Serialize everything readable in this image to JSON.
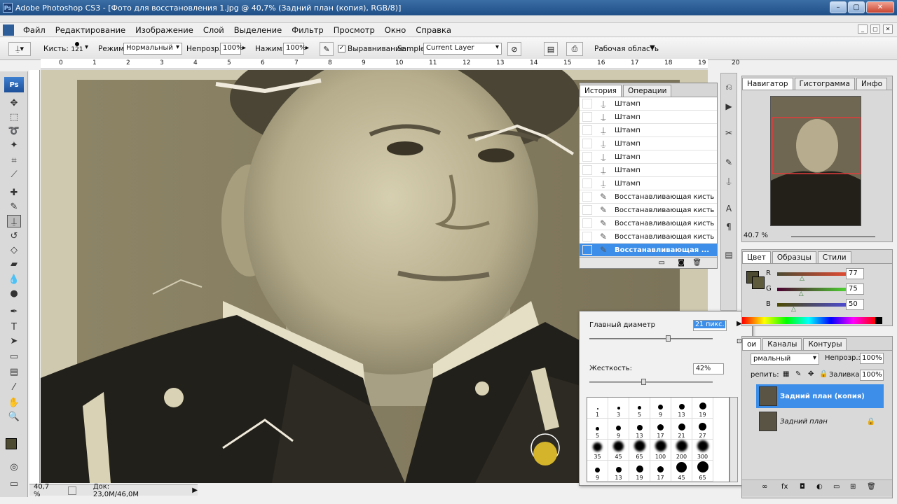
{
  "window": {
    "title": "Adobe Photoshop CS3 - [Фото для восстановления 1.jpg @ 40,7% (Задний план (копия), RGB/8)]",
    "app_badge": "Ps",
    "buttons": [
      "–",
      "▢",
      "✕"
    ]
  },
  "menu": {
    "items": [
      "Файл",
      "Редактирование",
      "Изображение",
      "Слой",
      "Выделение",
      "Фильтр",
      "Просмотр",
      "Окно",
      "Справка"
    ]
  },
  "options": {
    "brush_label": "Кисть:",
    "brush_size": "121",
    "mode_label": "Режим:",
    "mode_value": "Нормальный",
    "opacity_label": "Непрозр.:",
    "opacity_value": "100%",
    "flow_label": "Нажим:",
    "flow_value": "100%",
    "aligned_label": "Выравнивание",
    "sample_label": "Sample:",
    "sample_value": "Current Layer",
    "workspace_label": "Рабочая область"
  },
  "ruler": {
    "ticks": [
      "0",
      "1",
      "2",
      "3",
      "4",
      "5",
      "6",
      "7",
      "8",
      "9",
      "10",
      "11",
      "12",
      "13",
      "14",
      "15",
      "16",
      "17",
      "18",
      "19",
      "20"
    ]
  },
  "status": {
    "zoom": "40,7 %",
    "doc": "Док: 23,0M/46,0M"
  },
  "history": {
    "tabs": [
      "История",
      "Операции"
    ],
    "items": [
      {
        "label": "Штамп",
        "icon": "stamp-icon"
      },
      {
        "label": "Штамп",
        "icon": "stamp-icon"
      },
      {
        "label": "Штамп",
        "icon": "stamp-icon"
      },
      {
        "label": "Штамп",
        "icon": "stamp-icon"
      },
      {
        "label": "Штамп",
        "icon": "stamp-icon"
      },
      {
        "label": "Штамп",
        "icon": "stamp-icon"
      },
      {
        "label": "Штамп",
        "icon": "stamp-icon"
      },
      {
        "label": "Восстанавливающая кисть",
        "icon": "healing-brush-icon"
      },
      {
        "label": "Восстанавливающая кисть",
        "icon": "healing-brush-icon"
      },
      {
        "label": "Восстанавливающая кисть",
        "icon": "healing-brush-icon"
      },
      {
        "label": "Восстанавливающая кисть",
        "icon": "healing-brush-icon"
      },
      {
        "label": "Восстанавливающая ...",
        "icon": "healing-brush-icon"
      }
    ]
  },
  "brush_popup": {
    "diameter_label": "Главный диаметр",
    "diameter_value": "21 пикс.",
    "diameter_fraction": 0.62,
    "hardness_label": "Жесткость:",
    "hardness_value": "42%",
    "hardness_fraction": 0.42,
    "presets": [
      "1",
      "3",
      "5",
      "9",
      "13",
      "19",
      "5",
      "9",
      "13",
      "17",
      "21",
      "27",
      "35",
      "45",
      "65",
      "100",
      "200",
      "300",
      "9",
      "13",
      "19",
      "17",
      "45",
      "65"
    ]
  },
  "navigator": {
    "tabs": [
      "Навигатор",
      "Гистограмма",
      "Инфо"
    ],
    "zoom": "40.7 %"
  },
  "color_panel": {
    "tabs": [
      "Цвет",
      "Образцы",
      "Стили"
    ],
    "channels": [
      {
        "label": "R",
        "value": "77",
        "fraction": 0.3
      },
      {
        "label": "G",
        "value": "75",
        "fraction": 0.29
      },
      {
        "label": "B",
        "value": "50",
        "fraction": 0.2
      }
    ],
    "foreground": "#4d4b32"
  },
  "layers_panel": {
    "tabs": [
      "Слои",
      "Каналы",
      "Контуры"
    ],
    "tab0_visible": "ои",
    "blend_mode": "рмальный",
    "opacity_label": "Непрозр.:",
    "opacity_value": "100%",
    "lock_label": "репить:",
    "fill_label": "Заливка:",
    "fill_value": "100%",
    "layers": [
      {
        "name": "Задний план (копия)",
        "selected": true
      },
      {
        "name": "Задний план",
        "selected": false
      }
    ]
  },
  "colors": {
    "accent": "#3d8ee8",
    "title_bar": "#2a5d97"
  }
}
